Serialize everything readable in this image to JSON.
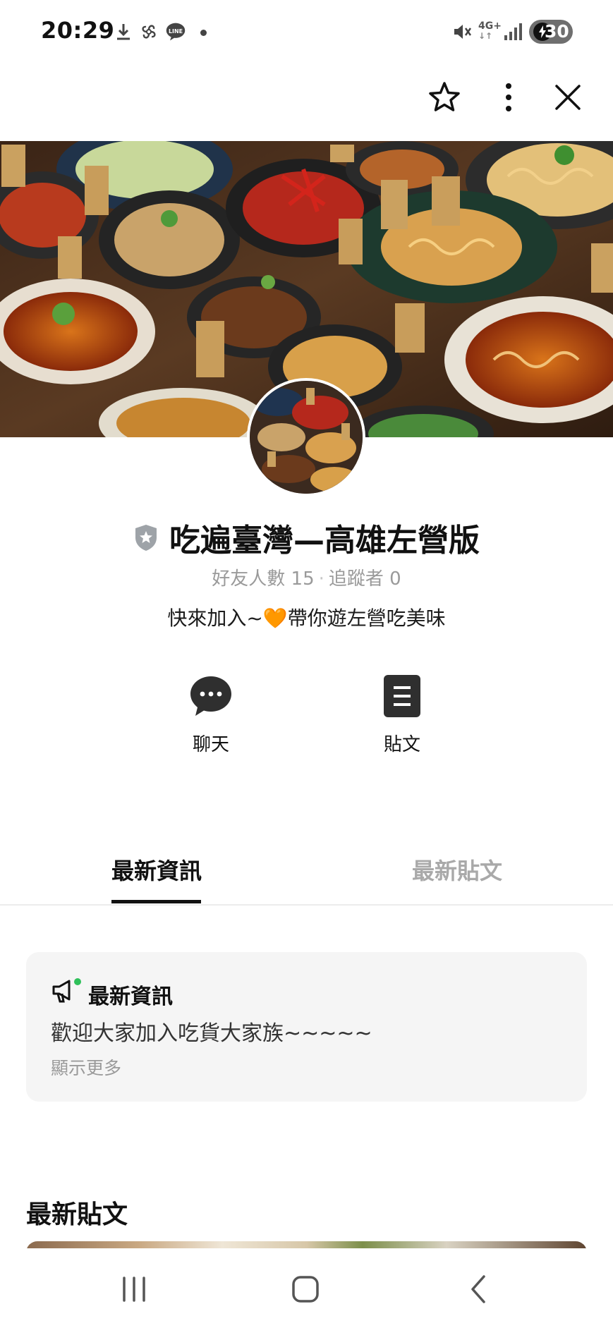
{
  "status_bar": {
    "time": "20:29",
    "network": "4G+",
    "battery": "30",
    "icons": [
      "download-icon",
      "pinwheel-icon",
      "line-app-icon",
      "notification-dot-icon",
      "mute-icon",
      "network-4g-icon",
      "signal-icon",
      "battery-charging-icon"
    ]
  },
  "top_bar": {
    "icons": [
      "star-icon",
      "more-vertical-icon",
      "close-icon"
    ]
  },
  "profile": {
    "name": "吃遍臺灣—高雄左營版",
    "friends_label": "好友人數 15",
    "followers_label": "追蹤者 0",
    "status_message": "快來加入~🧡帶你遊左營吃美味"
  },
  "actions": [
    {
      "label": "聊天",
      "icon": "chat-bubble-icon"
    },
    {
      "label": "貼文",
      "icon": "post-list-icon"
    }
  ],
  "tabs": [
    {
      "label": "最新資訊",
      "active": true
    },
    {
      "label": "最新貼文",
      "active": false
    }
  ],
  "announcement": {
    "title": "最新資訊",
    "body": "歡迎大家加入吃貨大家族~~~~~",
    "more": "顯示更多",
    "icon": "megaphone-icon"
  },
  "posts_section": {
    "heading": "最新貼文"
  },
  "nav_bar": {
    "icons": [
      "recent-apps-icon",
      "home-icon",
      "back-icon"
    ]
  },
  "colors": {
    "accent_green": "#2fc05a",
    "inactive_gray": "#a9a9a9",
    "card_bg": "#f5f5f5"
  }
}
